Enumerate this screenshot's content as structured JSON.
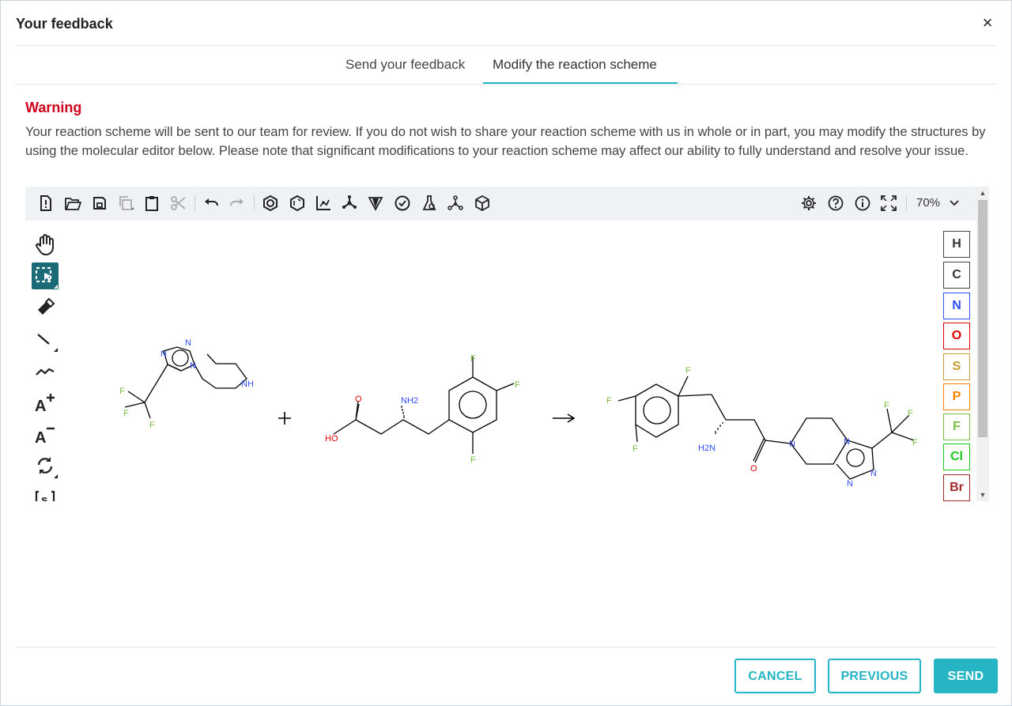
{
  "dialog": {
    "title": "Your feedback",
    "close_icon": "close-icon",
    "close_glyph": "×"
  },
  "tabs": [
    {
      "label": "Send your feedback",
      "active": false
    },
    {
      "label": "Modify the reaction scheme",
      "active": true
    }
  ],
  "warning": {
    "title": "Warning",
    "text": "Your reaction scheme will be sent to our team for review. If you do not wish to share your reaction scheme with us in whole or in part, you may modify the structures by using the molecular editor below. Please note that significant modifications to your reaction scheme may affect our ability to fully understand and resolve your issue."
  },
  "editor": {
    "toolbar_icons": [
      "new-file-icon",
      "open-folder-icon",
      "save-icon",
      "copy-icon",
      "paste-icon",
      "cut-icon",
      "undo-icon",
      "redo-icon",
      "aromatize-icon",
      "dearomatize-icon",
      "layout-icon",
      "clean-icon",
      "stereo-icon",
      "check-icon",
      "analyse-icon",
      "recognize-icon",
      "3d-view-icon",
      "settings-icon",
      "help-icon",
      "about-icon",
      "fullscreen-icon"
    ],
    "zoom": "70%",
    "left_tools": [
      "hand-icon",
      "select-icon",
      "eraser-icon",
      "bond-icon",
      "chain-icon",
      "charge-plus-icon",
      "charge-minus-icon",
      "rotate-icon",
      "sgroup-icon"
    ],
    "atoms": [
      {
        "symbol": "H",
        "color": "#000000"
      },
      {
        "symbol": "C",
        "color": "#000000"
      },
      {
        "symbol": "N",
        "color": "#304ff7"
      },
      {
        "symbol": "O",
        "color": "#e00000"
      },
      {
        "symbol": "S",
        "color": "#c99a2e"
      },
      {
        "symbol": "P",
        "color": "#ff8000"
      },
      {
        "symbol": "F",
        "color": "#78bc42"
      },
      {
        "symbol": "Cl",
        "color": "#1ec71e"
      },
      {
        "symbol": "Br",
        "color": "#a52828"
      }
    ],
    "reaction": {
      "plus": "+",
      "arrow": "→",
      "labels": {
        "n": "N",
        "nh": "NH",
        "f": "F",
        "o": "O",
        "ho": "HO",
        "nh2": "NH2",
        "h2n": "H2N"
      }
    }
  },
  "footer": {
    "cancel": "CANCEL",
    "previous": "PREVIOUS",
    "send": "SEND"
  },
  "colors": {
    "accent": "#26b5c4",
    "warning": "#d0021b",
    "active_tool": "#1a6a78",
    "nitrogen": "#304ff7",
    "oxygen": "#e00000",
    "fluorine": "#78bc42"
  }
}
